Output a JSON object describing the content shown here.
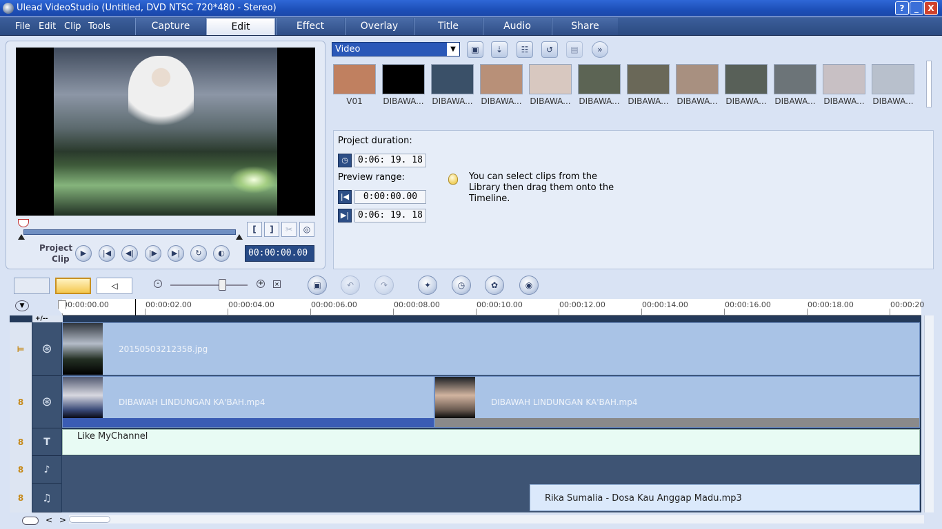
{
  "window": {
    "title": "Ulead VideoStudio (Untitled, DVD NTSC 720*480 - Stereo)",
    "help": "?",
    "minimize": "_",
    "close": "X"
  },
  "menu": [
    "File",
    "Edit",
    "Clip",
    "Tools"
  ],
  "tabs": [
    "Capture",
    "Edit",
    "Effect",
    "Overlay",
    "Title",
    "Audio",
    "Share"
  ],
  "active_tab": "Edit",
  "preview": {
    "mode_project": "Project",
    "mode_clip": "Clip",
    "timecode": "00:00:00.00",
    "mark_in": "[",
    "mark_out": "]",
    "controls": [
      "play",
      "home",
      "previous-frame",
      "next-frame",
      "end",
      "repeat",
      "volume"
    ]
  },
  "library": {
    "category": "Video",
    "thumbnails": [
      {
        "label": "V01",
        "color": "#c08060"
      },
      {
        "label": "DIBAWA...",
        "color": "#000000"
      },
      {
        "label": "DIBAWA...",
        "color": "#3a5068"
      },
      {
        "label": "DIBAWA...",
        "color": "#b89078"
      },
      {
        "label": "DIBAWA...",
        "color": "#d8c8c0"
      },
      {
        "label": "DIBAWA...",
        "color": "#5c6454"
      },
      {
        "label": "DIBAWA...",
        "color": "#6a6858"
      },
      {
        "label": "DIBAWA...",
        "color": "#a89080"
      },
      {
        "label": "DIBAWA...",
        "color": "#586058"
      },
      {
        "label": "DIBAWA...",
        "color": "#6c7478"
      },
      {
        "label": "DIBAWA...",
        "color": "#c8c0c4"
      },
      {
        "label": "DIBAWA...",
        "color": "#b8c0cc"
      }
    ]
  },
  "options": {
    "project_duration_label": "Project duration:",
    "project_duration": "0:06: 19. 18",
    "preview_range_label": "Preview range:",
    "range_start": "0:00:00.00",
    "range_end": "0:06: 19. 18",
    "hint": "You can select clips from the Library then drag them onto the Timeline."
  },
  "ruler": [
    "00:00:00.00",
    "00:00:02.00",
    "00:00:04.00",
    "00:00:06.00",
    "00:00:08.00",
    "00:00:10.00",
    "00:00:12.00",
    "00:00:14.00",
    "00:00:16.00",
    "00:00:18.00",
    "00:00:20"
  ],
  "tracks": {
    "video_clip": "20150503212358.jpg",
    "overlay_clip_1": "DIBAWAH LINDUNGAN KA'BAH.mp4",
    "overlay_clip_2": "DIBAWAH LINDUNGAN KA'BAH.mp4",
    "title_clip": "Like MyChannel",
    "music_clip": "Rika Sumalia - Dosa Kau Anggap Madu.mp3",
    "track_add_label": "+/--"
  },
  "colors": {
    "accent": "#2a58b8",
    "clip": "#a9c3e6",
    "title_track": "#e8fbf4",
    "music_clip": "#dbe9fb"
  }
}
